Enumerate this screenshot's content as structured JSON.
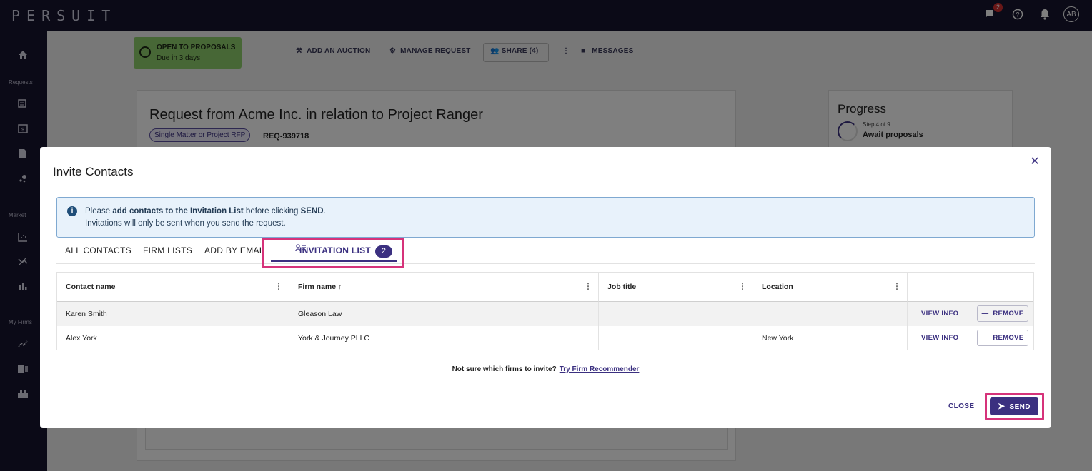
{
  "app": {
    "logo": "PERSUIT",
    "avatar_initials": "AB",
    "messages_count": "2"
  },
  "sidebar": {
    "sections": [
      "Requests",
      "Market",
      "My Firms"
    ],
    "icons": [
      "home-icon",
      "new-request-icon",
      "calendar-dollar-icon",
      "document-icon",
      "scatter-icon",
      "chart-icon",
      "trend-icon",
      "bar-chart-icon",
      "trend-line-icon",
      "id-card-icon",
      "firms-icon"
    ]
  },
  "background": {
    "status_title": "OPEN TO PROPOSALS",
    "status_due": "Due in 3 days",
    "actions": {
      "auction": "ADD AN AUCTION",
      "manage": "MANAGE REQUEST",
      "share": "SHARE (4)",
      "messages": "MESSAGES"
    },
    "request_title": "Request from Acme Inc. in relation to Project Ranger",
    "request_type": "Single Matter or Project RFP",
    "request_id": "REQ-939718",
    "progress_title": "Progress",
    "progress_step": "Step 4 of 9",
    "progress_status": "Await proposals"
  },
  "modal": {
    "title": "Invite Contacts",
    "info_prefix": "Please ",
    "info_bold": "add contacts to the Invitation List",
    "info_mid": " before clicking ",
    "info_send": "SEND",
    "info_end": ".",
    "info_line2": "Invitations will only be sent when you send the request.",
    "tabs": [
      "ALL CONTACTS",
      "FIRM LISTS",
      "ADD BY EMAIL",
      "INVITATION LIST"
    ],
    "invitation_count": "2",
    "columns": [
      "Contact name",
      "Firm name",
      "Job title",
      "Location"
    ],
    "rows": [
      {
        "contact": "Karen Smith",
        "firm": "Gleason Law",
        "job": "",
        "location": ""
      },
      {
        "contact": "Alex York",
        "firm": "York & Journey PLLC",
        "job": "",
        "location": "New York"
      }
    ],
    "view_info": "VIEW INFO",
    "remove": "REMOVE",
    "recommend_text": "Not sure which firms to invite?",
    "recommend_link": "Try Firm Recommender",
    "close": "CLOSE",
    "send": "SEND"
  }
}
